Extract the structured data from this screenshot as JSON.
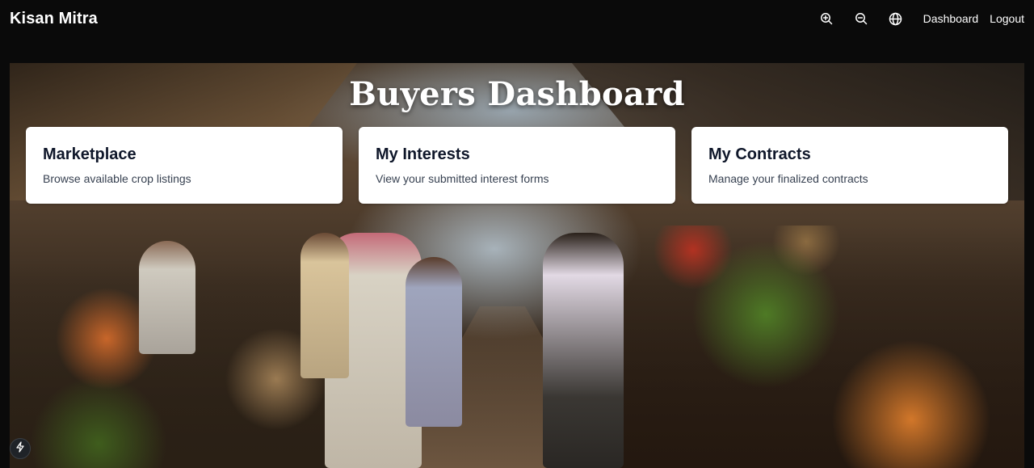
{
  "navbar": {
    "brand": "Kisan Mitra",
    "icons": [
      "zoom-in-icon",
      "zoom-out-icon",
      "globe-icon"
    ],
    "links": {
      "dashboard": "Dashboard",
      "logout": "Logout"
    }
  },
  "hero": {
    "title": "Buyers Dashboard",
    "background": "market-street-photo"
  },
  "cards": [
    {
      "title": "Marketplace",
      "description": "Browse available crop listings"
    },
    {
      "title": "My Interests",
      "description": "View your submitted interest forms"
    },
    {
      "title": "My Contracts",
      "description": "Manage your finalized contracts"
    }
  ],
  "floating_button": {
    "icon": "lightning-icon"
  },
  "colors": {
    "navbar_bg": "#0a0a0a",
    "card_bg": "#ffffff",
    "card_title": "#0f172a",
    "card_text": "#374151"
  }
}
